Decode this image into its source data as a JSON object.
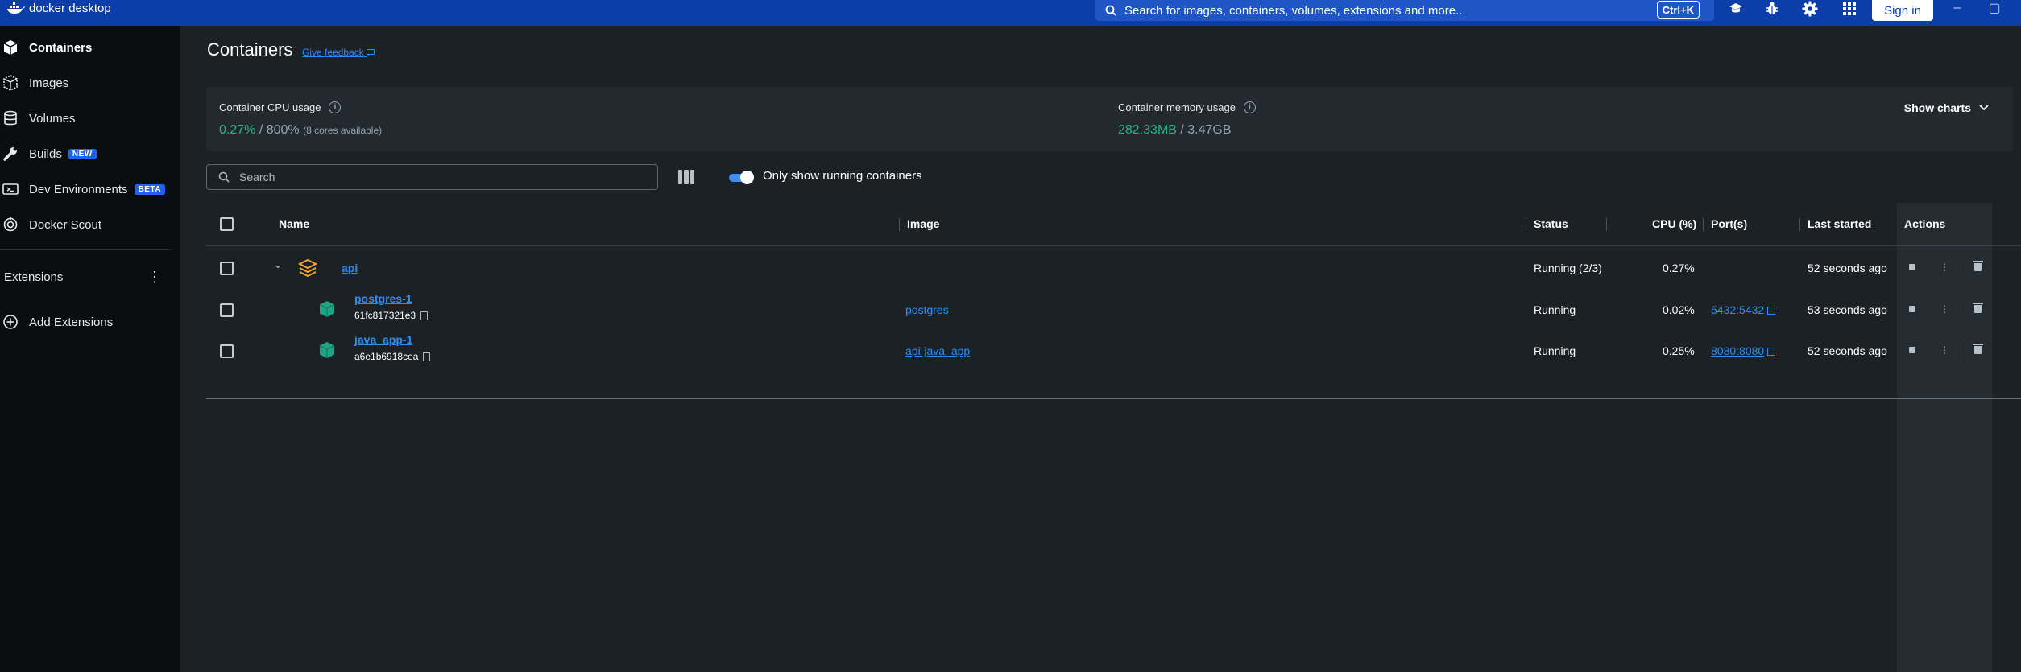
{
  "app": {
    "logo_text": "docker desktop",
    "search_placeholder": "Search for images, containers, volumes, extensions and more...",
    "search_shortcut": "Ctrl+K",
    "sign_in": "Sign in",
    "minimize": "–",
    "restore": "▢"
  },
  "colors": {
    "topbar": "#0b3ea8",
    "accent": "#2d8df5",
    "cpu_green": "#27b48c",
    "sidebar": "#0a0d10"
  },
  "sidebar": {
    "items": [
      {
        "label": "Containers",
        "icon": "container-icon",
        "active": true
      },
      {
        "label": "Images",
        "icon": "images-icon"
      },
      {
        "label": "Volumes",
        "icon": "volumes-icon"
      },
      {
        "label": "Builds",
        "icon": "wrench-icon",
        "badge": "NEW"
      },
      {
        "label": "Dev Environments",
        "icon": "dev-env-icon",
        "badge": "BETA"
      },
      {
        "label": "Docker Scout",
        "icon": "scout-icon"
      }
    ],
    "extensions_title": "Extensions",
    "add_extensions": "Add Extensions"
  },
  "main": {
    "title": "Containers",
    "feedback": "Give feedback",
    "cpu": {
      "label": "Container CPU usage",
      "value": "0.27%",
      "total": "/ 800%",
      "note": "(8 cores available)"
    },
    "memory": {
      "label": "Container memory usage",
      "value": "282.33MB",
      "total": "/ 3.47GB"
    },
    "show_charts": "Show charts",
    "search_placeholder": "Search",
    "toggle_label": "Only show running containers",
    "toggle_on": true
  },
  "table": {
    "headers": {
      "name": "Name",
      "image": "Image",
      "status": "Status",
      "cpu": "CPU (%)",
      "ports": "Port(s)",
      "last_started": "Last started",
      "actions": "Actions"
    },
    "rows": [
      {
        "name": "api",
        "id": "",
        "image": "",
        "status": "Running (2/3)",
        "cpu": "0.27%",
        "ports": "",
        "last_started": "52 seconds ago",
        "group": true
      },
      {
        "name": "postgres-1",
        "id": "61fc817321e3",
        "image": "postgres",
        "status": "Running",
        "cpu": "0.02%",
        "ports": "5432:5432",
        "last_started": "53 seconds ago"
      },
      {
        "name": "java_app-1",
        "id": "a6e1b6918cea",
        "image": "api-java_app",
        "status": "Running",
        "cpu": "0.25%",
        "ports": "8080:8080",
        "last_started": "52 seconds ago"
      }
    ]
  }
}
